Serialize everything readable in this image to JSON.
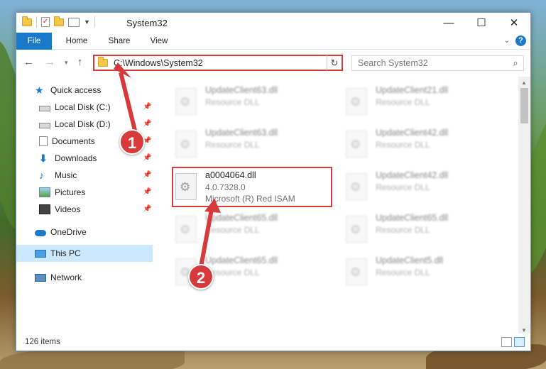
{
  "window": {
    "title": "System32",
    "controls": [
      "—",
      "☐",
      "✕"
    ]
  },
  "ribbon": {
    "tabs": [
      "File",
      "Home",
      "Share",
      "View"
    ]
  },
  "navigation": {
    "address": "C:\\Windows\\System32",
    "search_placeholder": "Search System32"
  },
  "sidebar": {
    "items": [
      {
        "label": "Quick access",
        "icon": "star-icon"
      },
      {
        "label": "Local Disk (C:)",
        "icon": "disk-icon",
        "pinned": true
      },
      {
        "label": "Local Disk (D:)",
        "icon": "disk-icon",
        "pinned": true
      },
      {
        "label": "Documents",
        "icon": "documents-icon",
        "pinned": true
      },
      {
        "label": "Downloads",
        "icon": "downloads-icon",
        "pinned": true
      },
      {
        "label": "Music",
        "icon": "music-icon",
        "pinned": true
      },
      {
        "label": "Pictures",
        "icon": "pictures-icon",
        "pinned": true
      },
      {
        "label": "Videos",
        "icon": "videos-icon",
        "pinned": true
      },
      {
        "label": "OneDrive",
        "icon": "onedrive-icon"
      },
      {
        "label": "This PC",
        "icon": "pc-icon",
        "selected": true
      },
      {
        "label": "Network",
        "icon": "network-icon"
      }
    ]
  },
  "files": {
    "left": [
      {
        "name": "UpdateClient63.dll",
        "type": "Resource DLL"
      },
      {
        "name": "UpdateClient63.dll",
        "type": "Resource DLL"
      },
      {
        "name": "a0004064.dll",
        "version": "4.0.7328.0",
        "description": "Microsoft (R) Red ISAM"
      },
      {
        "name": "UpdateClient65.dll",
        "type": "Resource DLL"
      },
      {
        "name": "UpdateClient65.dll",
        "type": "Resource DLL"
      }
    ],
    "right": [
      {
        "name": "UpdateClient21.dll",
        "type": "Resource DLL"
      },
      {
        "name": "UpdateClient42.dll",
        "type": "Resource DLL"
      },
      {
        "name": "UpdateClient42.dll",
        "type": "Resource DLL"
      },
      {
        "name": "UpdateClient65.dll",
        "type": "Resource DLL"
      },
      {
        "name": "UpdateClient5.dll",
        "type": "Resource DLL"
      }
    ]
  },
  "status": {
    "item_count": "126 items"
  },
  "callouts": [
    "1",
    "2"
  ],
  "colors": {
    "accent": "#1979ca",
    "highlight": "#d63a3a",
    "selection": "#cce8ff"
  }
}
